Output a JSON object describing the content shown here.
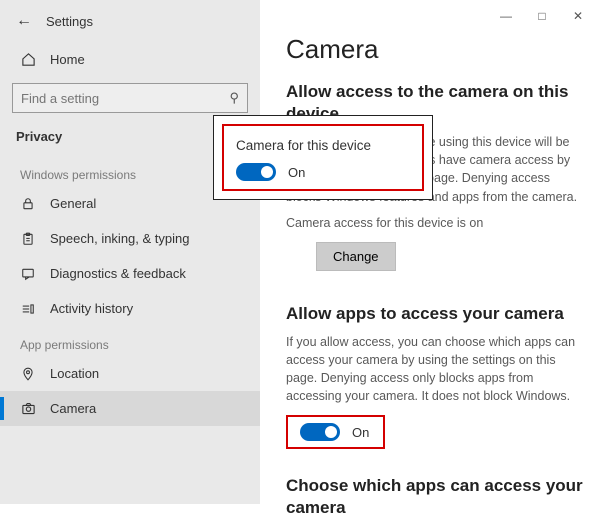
{
  "app_title": "Settings",
  "search": {
    "placeholder": "Find a setting"
  },
  "nav": {
    "home": "Home",
    "current_section": "Privacy",
    "groups": {
      "windows_permissions": {
        "label": "Windows permissions",
        "items": {
          "general": "General",
          "speech": "Speech, inking, & typing",
          "diagnostics": "Diagnostics & feedback",
          "activity": "Activity history"
        }
      },
      "app_permissions": {
        "label": "App permissions",
        "items": {
          "location": "Location",
          "camera": "Camera"
        }
      }
    }
  },
  "page": {
    "title": "Camera",
    "section1": {
      "heading": "Allow access to the camera on this device",
      "body": "If you allow access, people using this device will be able to choose if their apps have camera access by using the settings on this page. Denying access blocks Windows features and apps from the camera.",
      "status": "Camera access for this device is on",
      "change_button": "Change"
    },
    "section2": {
      "heading": "Allow apps to access your camera",
      "body": "If you allow access, you can choose which apps can access your camera by using the settings on this page. Denying access only blocks apps from accessing your camera. It does not block Windows.",
      "toggle_state": "On"
    },
    "section3": {
      "heading": "Choose which apps can access your camera"
    }
  },
  "popup": {
    "title": "Camera for this device",
    "toggle_state": "On"
  }
}
